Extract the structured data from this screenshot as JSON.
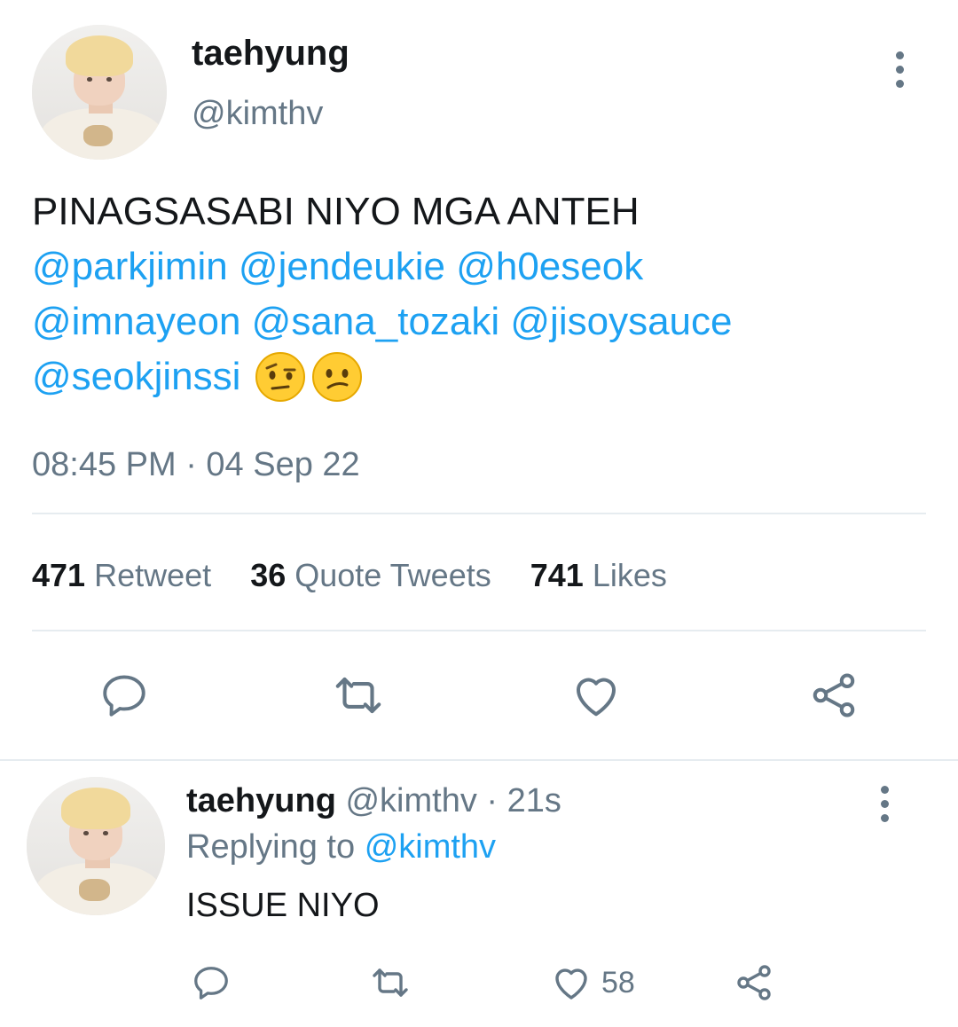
{
  "main_tweet": {
    "display_name": "taehyung",
    "handle": "@kimthv",
    "text": "PINAGSASABI NIYO MGA ANTEH",
    "mentions_line1": "@parkjimin @jendeukie @h0eseok",
    "mentions_line2": "@imnayeon @sana_tozaki @jisoysauce",
    "mentions_line3": "@seokjinssi",
    "emojis": [
      "raised-eyebrow-emoji",
      "confused-face-emoji"
    ],
    "timestamp": "08:45 PM · 04 Sep 22",
    "stats": {
      "retweets_count": "471",
      "retweets_label": "Retweet",
      "quotes_count": "36",
      "quotes_label": "Quote Tweets",
      "likes_count": "741",
      "likes_label": "Likes"
    },
    "actions": [
      "reply-icon",
      "retweet-icon",
      "like-icon",
      "share-icon"
    ]
  },
  "reply_tweet": {
    "display_name": "taehyung",
    "handle": "@kimthv",
    "time": "· 21s",
    "replying_prefix": "Replying to",
    "replying_handle": "@kimthv",
    "text": "ISSUE NIYO",
    "like_count": "58",
    "actions": [
      "reply-icon",
      "retweet-icon",
      "like-icon",
      "share-icon"
    ]
  },
  "colors": {
    "link": "#1da1f2",
    "secondary_text": "#657786",
    "primary_text": "#14171a",
    "divider": "#e6ecf0"
  }
}
